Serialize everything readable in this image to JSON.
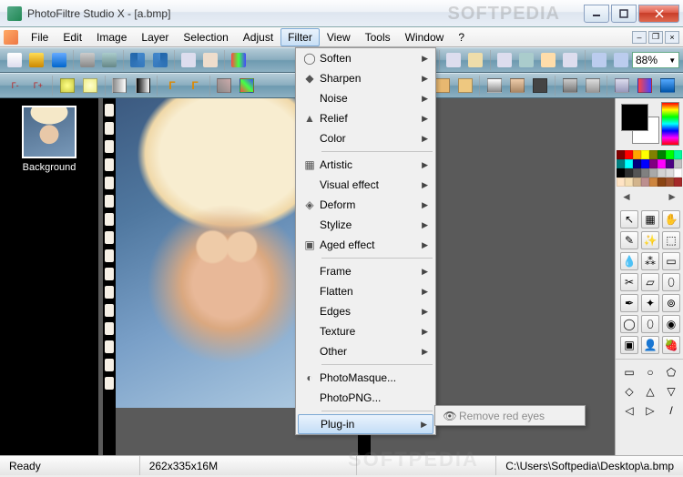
{
  "title": "PhotoFiltre Studio X - [a.bmp]",
  "watermark": "SOFTPEDIA",
  "menu": {
    "items": [
      "File",
      "Edit",
      "Image",
      "Layer",
      "Selection",
      "Adjust",
      "Filter",
      "View",
      "Tools",
      "Window",
      "?"
    ],
    "active": "Filter"
  },
  "zoom": "88%",
  "layer": {
    "label": "Background"
  },
  "dropdown": {
    "groups": [
      [
        {
          "label": "Soften",
          "icon": "soften-icon",
          "arrow": true
        },
        {
          "label": "Sharpen",
          "icon": "sharpen-icon",
          "arrow": true
        },
        {
          "label": "Noise",
          "icon": "",
          "arrow": true
        },
        {
          "label": "Relief",
          "icon": "relief-icon",
          "arrow": true
        },
        {
          "label": "Color",
          "icon": "",
          "arrow": true
        }
      ],
      [
        {
          "label": "Artistic",
          "icon": "artistic-icon",
          "arrow": true
        },
        {
          "label": "Visual effect",
          "icon": "",
          "arrow": true
        },
        {
          "label": "Deform",
          "icon": "deform-icon",
          "arrow": true
        },
        {
          "label": "Stylize",
          "icon": "",
          "arrow": true
        },
        {
          "label": "Aged effect",
          "icon": "aged-icon",
          "arrow": true
        }
      ],
      [
        {
          "label": "Frame",
          "icon": "",
          "arrow": true
        },
        {
          "label": "Flatten",
          "icon": "",
          "arrow": true
        },
        {
          "label": "Edges",
          "icon": "",
          "arrow": true
        },
        {
          "label": "Texture",
          "icon": "",
          "arrow": true
        },
        {
          "label": "Other",
          "icon": "",
          "arrow": true
        }
      ],
      [
        {
          "label": "PhotoMasque...",
          "icon": "photomasque-icon",
          "arrow": false
        },
        {
          "label": "PhotoPNG...",
          "icon": "",
          "arrow": false
        }
      ],
      [
        {
          "label": "Plug-in",
          "icon": "",
          "arrow": true,
          "hl": true
        }
      ]
    ]
  },
  "submenu": {
    "label": "Remove red eyes",
    "icon": "redeye-icon"
  },
  "status": {
    "ready": "Ready",
    "dims": "262x335x16M",
    "coords": "",
    "path": "C:\\Users\\Softpedia\\Desktop\\a.bmp"
  },
  "palette_colors": [
    "#800000",
    "#f00",
    "#ffa500",
    "#ff0",
    "#808000",
    "#008000",
    "#0f0",
    "#00fa9a",
    "#008080",
    "#0ff",
    "#000080",
    "#00f",
    "#800080",
    "#f0f",
    "#4b0082",
    "#c0c0c0",
    "#000",
    "#2f2f2f",
    "#555",
    "#808080",
    "#a9a9a9",
    "#d3d3d3",
    "#dcdcdc",
    "#fff",
    "#ffe4c4",
    "#f5deb3",
    "#d2b48c",
    "#bc8f8f",
    "#cd853f",
    "#8b4513",
    "#a0522d",
    "#a52a2a"
  ],
  "tools": [
    "↖",
    "▦",
    "✋",
    "✎",
    "✨",
    "⬚",
    "💧",
    "⁂",
    "▭",
    "✂",
    "▱",
    "⬯",
    "✒",
    "✦",
    "⊚",
    "◯",
    "⬯",
    "◉",
    "▣",
    "👤",
    "🍓"
  ],
  "shapes": [
    "▭",
    "○",
    "⬠",
    "◇",
    "△",
    "▽",
    "◁",
    "▷",
    "/"
  ]
}
